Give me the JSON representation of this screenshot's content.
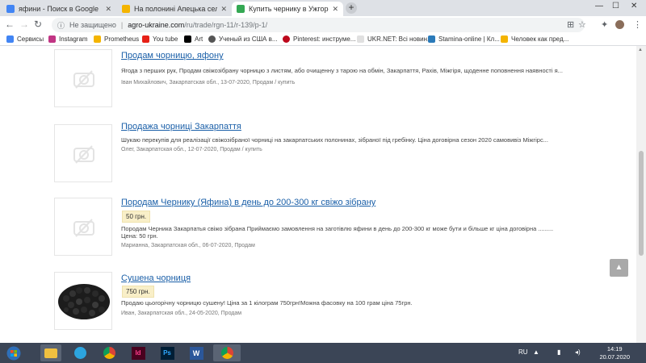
{
  "browser": {
    "tabs": [
      {
        "title": "яфини - Поиск в Google",
        "fav_color": "#4285f4"
      },
      {
        "title": "На полонині Апецька селяни з...",
        "fav_color": "#f4b400"
      },
      {
        "title": "Купить чернику в Ужгороде / З...",
        "fav_color": "#34a853"
      }
    ],
    "new_tab_label": "+",
    "window_controls": {
      "min": "—",
      "max": "☐",
      "close": "✕"
    },
    "omnibox": {
      "security": "Не защищено",
      "host": "agro-ukraine.com",
      "path": "/ru/trade/rgn-11/r-139/p-1/"
    },
    "bookmarks": [
      {
        "label": "Сервисы",
        "color": "#4285f4"
      },
      {
        "label": "Instagram",
        "color": "#c13584"
      },
      {
        "label": "Prometheus",
        "color": "#f4b400"
      },
      {
        "label": "You tube",
        "color": "#e62117"
      },
      {
        "label": "Art",
        "color": "#000000"
      },
      {
        "label": "Ученый из США в...",
        "color": "#555555"
      },
      {
        "label": "Pinterest: инструме...",
        "color": "#bd081c"
      },
      {
        "label": "UKR.NET: Всі новин...",
        "color": "#e0e0e0"
      },
      {
        "label": "Stamina-online | Кл...",
        "color": "#2a7ab9"
      },
      {
        "label": "Человек как пред...",
        "color": "#f4b400"
      }
    ]
  },
  "listings": [
    {
      "title": "Продам чорницю, яфону",
      "price": "",
      "desc": "Ягода з перших рук, Продам свіжозібрану чорницю з листям, або очищенну з тарою на обмін, Закарпаття, Рахів, Міжгіря, щоденне поповнення наявності я...",
      "meta": "Іван Михайлович, Закарпатская обл., 13-07-2020, Продам / купить"
    },
    {
      "title": "Продажа чорниці Закарпаття",
      "price": "",
      "desc": "Шукаю перекупів для реалізації свіжозібраної чорниці на закарпатських полонинах, зібраної під гребінку. Ціна договірна сезон 2020 самовивіз Міжгірс...",
      "meta": "Олег, Закарпатская обл., 12-07-2020, Продам / купить"
    },
    {
      "title": "Породам Чернику (Яфина) в день до 200-300 кг свіжо зібрану",
      "price": "50 грн.",
      "desc": "Породам Черника Закарпатья свіжо зібрана Приймаємо замовлення на заготівлю яфини в день до 200-300 кг може бути и більше кг ціна договірна .........",
      "desc2": "Цена: 50 грн.",
      "meta": "Марианна, Закарпатская обл., 06-07-2020, Продам"
    },
    {
      "title": "Сушена чорниця",
      "price": "750 грн.",
      "desc": "Продаю цьогорічну чорницю сушену! Ціна за 1 кілограм 750грн!Можна фасовку на 100 грам ціна 75грн.",
      "meta": "Иван, Закарпатская обл., 24-05-2020, Продам"
    }
  ],
  "taskbar": {
    "apps": [
      {
        "name": "start",
        "label": "",
        "color": "#3b78d8"
      },
      {
        "name": "explorer",
        "label": "",
        "color": "#f0c040"
      },
      {
        "name": "telegram",
        "label": "",
        "color": "#2ca5e0"
      },
      {
        "name": "chrome",
        "label": "",
        "color": "#e0e0e0"
      },
      {
        "name": "indesign",
        "label": "Id",
        "color": "#49021f"
      },
      {
        "name": "photoshop",
        "label": "Ps",
        "color": "#001e36"
      },
      {
        "name": "word",
        "label": "W",
        "color": "#2b579a"
      },
      {
        "name": "chrome-active",
        "label": "",
        "color": "#5a6474"
      }
    ],
    "lang": "RU",
    "time": "14:19",
    "date": "20.07.2020"
  }
}
